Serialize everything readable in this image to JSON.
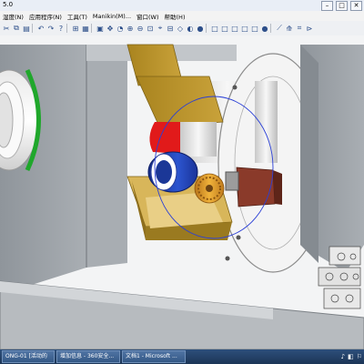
{
  "window": {
    "title": "5.0",
    "min_glyph": "–",
    "max_glyph": "□",
    "close_glyph": "✕"
  },
  "menu": {
    "items": [
      {
        "label": "湿度(N)"
      },
      {
        "label": "应用程序(N)"
      },
      {
        "label": "工具(T)"
      },
      {
        "label": "Manikin(M)..."
      },
      {
        "label": "窗口(W)"
      },
      {
        "label": "帮助(H)"
      }
    ]
  },
  "toolbar": {
    "icons": [
      {
        "name": "cut-icon",
        "glyph": "✂"
      },
      {
        "name": "copy-icon",
        "glyph": "⧉"
      },
      {
        "name": "paste-icon",
        "glyph": "▤"
      },
      {
        "name": "undo-icon",
        "glyph": "↶"
      },
      {
        "name": "redo-icon",
        "glyph": "↷"
      },
      {
        "name": "help-icon",
        "glyph": "?"
      },
      {
        "name": "tree-icon",
        "glyph": "⊞"
      },
      {
        "name": "table-icon",
        "glyph": "▦"
      },
      {
        "name": "fit-all-icon",
        "glyph": "▣"
      },
      {
        "name": "pan-icon",
        "glyph": "✥"
      },
      {
        "name": "rotate-icon",
        "glyph": "◔"
      },
      {
        "name": "zoom-in-icon",
        "glyph": "⊕"
      },
      {
        "name": "zoom-out-icon",
        "glyph": "⊖"
      },
      {
        "name": "zoom-area-icon",
        "glyph": "⊡"
      },
      {
        "name": "normal-view-icon",
        "glyph": "⌖"
      },
      {
        "name": "multi-view-icon",
        "glyph": "⊟"
      },
      {
        "name": "iso-view-icon",
        "glyph": "◇"
      },
      {
        "name": "shading-icon",
        "glyph": "◐"
      },
      {
        "name": "render-icon",
        "glyph": "●"
      },
      {
        "name": "box-view-1-icon",
        "glyph": "□"
      },
      {
        "name": "box-view-2-icon",
        "glyph": "□"
      },
      {
        "name": "box-view-3-icon",
        "glyph": "□"
      },
      {
        "name": "box-view-4-icon",
        "glyph": "□"
      },
      {
        "name": "box-view-5-icon",
        "glyph": "□"
      },
      {
        "name": "sphere-icon",
        "glyph": "●"
      },
      {
        "name": "measure-icon",
        "glyph": "⟋"
      },
      {
        "name": "analysis-icon",
        "glyph": "⟰"
      },
      {
        "name": "snap-icon",
        "glyph": "⌗"
      },
      {
        "name": "extra-icon",
        "glyph": "⊳"
      }
    ]
  },
  "taskbar": {
    "items": [
      {
        "label": "ONG-01 [活动的"
      },
      {
        "label": "增加信息 - 360安全..."
      },
      {
        "label": "文档1 - Microsoft ..."
      }
    ],
    "tray_icons": [
      "♪",
      "◧",
      "⚐"
    ]
  },
  "colors": {
    "frame_gray": "#9a9fa4",
    "frame_dark": "#7d8287",
    "bracket_gold": "#b8922a",
    "flange_white": "#f4f4f4",
    "red_band": "#e11a1a",
    "motor_blue": "#1f3fa8",
    "gear_gold": "#d9961f",
    "brown_block": "#8a3a2a",
    "green_marker": "#1fa72b",
    "circle_blue": "#2a3fd6"
  }
}
